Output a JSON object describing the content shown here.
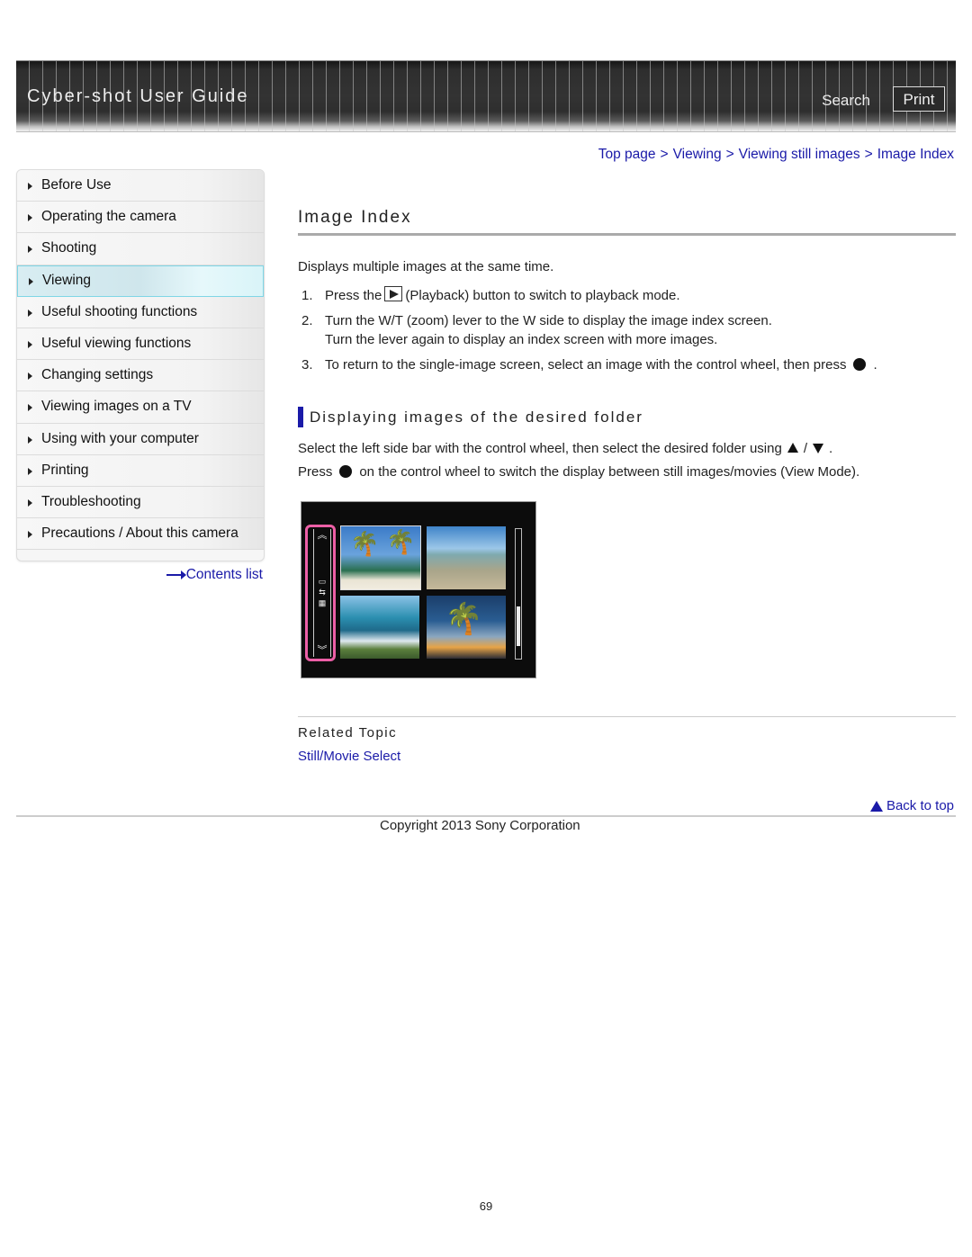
{
  "header": {
    "title": "Cyber-shot User Guide",
    "search_label": "Search",
    "print_label": "Print"
  },
  "breadcrumb": [
    {
      "label": "Top page"
    },
    {
      "label": "Viewing"
    },
    {
      "label": "Viewing still images"
    },
    {
      "label": "Image Index"
    }
  ],
  "breadcrumb_separator": ">",
  "sidebar": {
    "items": [
      {
        "label": "Before Use",
        "active": false
      },
      {
        "label": "Operating the camera",
        "active": false
      },
      {
        "label": "Shooting",
        "active": false
      },
      {
        "label": "Viewing",
        "active": true
      },
      {
        "label": "Useful shooting functions",
        "active": false
      },
      {
        "label": "Useful viewing functions",
        "active": false
      },
      {
        "label": "Changing settings",
        "active": false
      },
      {
        "label": "Viewing images on a TV",
        "active": false
      },
      {
        "label": "Using with your computer",
        "active": false
      },
      {
        "label": "Printing",
        "active": false
      },
      {
        "label": "Troubleshooting",
        "active": false
      },
      {
        "label": "Precautions / About this camera",
        "active": false
      }
    ],
    "contents_link": "Contents list"
  },
  "main": {
    "title": "Image Index",
    "intro": "Displays multiple images at the same time.",
    "steps": [
      {
        "num": "1.",
        "before_icon": "Press the",
        "icon": "playback-icon",
        "after_icon": "(Playback) button to switch to playback mode."
      },
      {
        "num": "2.",
        "line1": "Turn the W/T (zoom) lever to the W side to display the image index screen.",
        "line2": "Turn the lever again to display an index screen with more images."
      },
      {
        "num": "3.",
        "text": "To return to the single-image screen, select an image with the control wheel, then press",
        "icon": "center-button-icon",
        "suffix": "."
      }
    ],
    "section": {
      "heading": "Displaying images of the desired folder",
      "para1_text": "Select the left side bar with the control wheel, then select the desired folder using",
      "para1_sep": "/",
      "para1_suffix": ".",
      "para2_prefix": "Press",
      "para2_text": "on the control wheel to switch the display between still images/movies (View Mode)."
    },
    "illustration": {
      "description": "Camera image index screen with left side bar highlighted",
      "highlight_color": "#ec5fa6",
      "scroll_position": 0.6
    },
    "related": {
      "title": "Related Topic",
      "links": [
        {
          "label": "Still/Movie Select"
        }
      ]
    }
  },
  "footer": {
    "back_to_top": "Back to top",
    "copyright": "Copyright 2013 Sony Corporation",
    "page_number": "69"
  },
  "colors": {
    "link": "#1a1aa8",
    "active_nav": "#cfe6ec",
    "accent_bar": "#1a1aa8"
  }
}
